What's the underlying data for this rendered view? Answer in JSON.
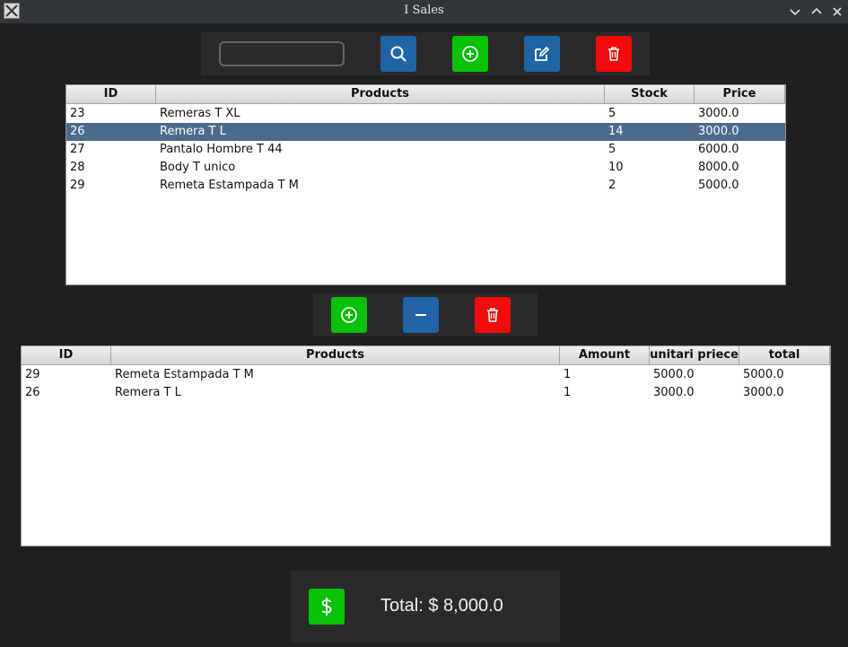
{
  "window": {
    "title": "I Sales"
  },
  "toolbar": {
    "search_value": ""
  },
  "products_table": {
    "columns": [
      "ID",
      "Products",
      "Stock",
      "Price"
    ],
    "rows": [
      [
        "23",
        "Remeras T XL",
        "5",
        "3000.0"
      ],
      [
        "26",
        "Remera T L",
        "14",
        "3000.0"
      ],
      [
        "27",
        "Pantalo Hombre T 44",
        "5",
        "6000.0"
      ],
      [
        "28",
        "Body T unico",
        "10",
        "8000.0"
      ],
      [
        "29",
        "Remeta Estampada T M",
        "2",
        "5000.0"
      ]
    ],
    "selected_row": 1
  },
  "cart_table": {
    "columns": [
      "ID",
      "Products",
      "Amount",
      "unitari priece",
      "total"
    ],
    "rows": [
      [
        "29",
        "Remeta Estampada T M",
        "1",
        "5000.0",
        "5000.0"
      ],
      [
        "26",
        "Remera T L",
        "1",
        "3000.0",
        "3000.0"
      ]
    ]
  },
  "footer": {
    "total_label": "Total: $ 8,000.0"
  },
  "colors": {
    "blue": "#1f65a6",
    "green": "#08c208",
    "red": "#f30a0a",
    "selection": "#4a6b8c"
  }
}
